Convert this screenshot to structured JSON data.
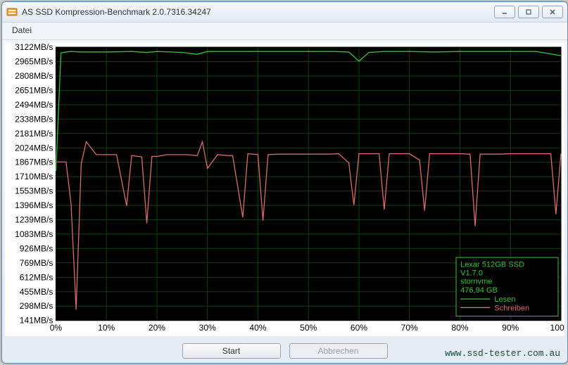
{
  "window": {
    "title": "AS SSD Kompression-Benchmark 2.0.7316.34247"
  },
  "menubar": {
    "item0": "Datei"
  },
  "buttons": {
    "start": "Start",
    "cancel": "Abbrechen"
  },
  "watermark": "www.ssd-tester.com.au",
  "legend": {
    "device": "Lexar 512GB SSD",
    "version": "V1.7.0",
    "driver": "stornvme",
    "capacity": "476,94 GB",
    "series_read": "Lesen",
    "series_write": "Schreiben"
  },
  "chart_data": {
    "type": "line",
    "xlabel": "",
    "ylabel": "",
    "x_ticks": [
      "0%",
      "10%",
      "20%",
      "30%",
      "40%",
      "50%",
      "60%",
      "70%",
      "80%",
      "90%",
      "100%"
    ],
    "y_ticks_values": [
      141,
      298,
      455,
      612,
      769,
      926,
      1083,
      1239,
      1396,
      1553,
      1710,
      1867,
      2024,
      2181,
      2338,
      2494,
      2651,
      2808,
      2965,
      3122
    ],
    "y_unit": "MB/s",
    "xlim": [
      0,
      100
    ],
    "ylim": [
      141,
      3122
    ],
    "series": [
      {
        "name": "Lesen",
        "color": "#35c335",
        "x": [
          0,
          1,
          2,
          3,
          5,
          10,
          15,
          18,
          20,
          25,
          28,
          30,
          35,
          40,
          45,
          50,
          55,
          58,
          60,
          62,
          65,
          70,
          75,
          80,
          85,
          90,
          95,
          100
        ],
        "y": [
          1770,
          3060,
          3070,
          3075,
          3070,
          3070,
          3075,
          3065,
          3075,
          3065,
          3045,
          3075,
          3075,
          3075,
          3075,
          3075,
          3075,
          3070,
          2970,
          3065,
          3075,
          3075,
          3070,
          3075,
          3075,
          3075,
          3075,
          3030
        ]
      },
      {
        "name": "Schreiben",
        "color": "#d86b6b",
        "x": [
          0,
          1,
          2,
          3,
          4,
          5,
          6,
          8,
          10,
          12,
          14,
          15,
          17,
          18,
          19,
          20,
          22,
          24,
          26,
          28,
          29,
          30,
          32,
          34,
          35,
          37,
          38,
          40,
          41,
          42,
          44,
          46,
          48,
          50,
          52,
          54,
          56,
          58,
          59,
          60,
          62,
          64,
          65,
          66,
          68,
          70,
          72,
          73,
          74,
          76,
          78,
          80,
          82,
          83,
          84,
          86,
          88,
          90,
          92,
          94,
          96,
          98,
          99,
          100
        ],
        "y": [
          1870,
          1870,
          1870,
          1410,
          260,
          1850,
          2090,
          1950,
          1950,
          1950,
          1390,
          1940,
          1925,
          1200,
          1930,
          1930,
          1950,
          1950,
          1950,
          1940,
          2090,
          1800,
          1950,
          1940,
          1940,
          1265,
          1960,
          1950,
          1230,
          1950,
          1955,
          1955,
          1955,
          1955,
          1955,
          1955,
          1960,
          1860,
          1400,
          1960,
          1960,
          1960,
          1350,
          1960,
          1960,
          1960,
          1890,
          1340,
          1960,
          1960,
          1960,
          1960,
          1955,
          1170,
          1955,
          1955,
          1955,
          1960,
          1960,
          1960,
          1960,
          1960,
          1300,
          1960
        ]
      }
    ]
  }
}
